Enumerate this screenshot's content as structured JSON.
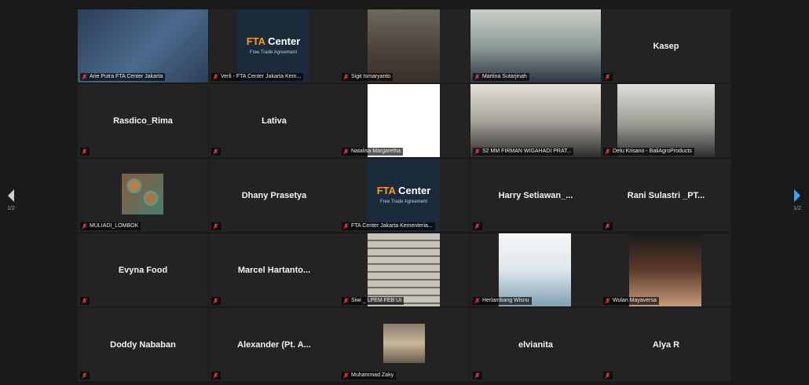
{
  "participants": [
    {
      "kind": "video",
      "video": "v-slide",
      "label": "Arie Putra FTA Center Jakarta",
      "active": true
    },
    {
      "kind": "video",
      "video": "v-fta",
      "label": "Verli - FTA Center Jakarta Kem...",
      "fta": true
    },
    {
      "kind": "video",
      "video": "v-room",
      "label": "Sigit Ismaryanto"
    },
    {
      "kind": "video",
      "video": "v-person1",
      "label": "Martina Sutarjinah"
    },
    {
      "kind": "name",
      "name": "Kasep"
    },
    {
      "kind": "name",
      "name": "Rasdico_Rima"
    },
    {
      "kind": "name",
      "name": "Lativa"
    },
    {
      "kind": "video",
      "video": "v-white",
      "label": "Natalisa Margaretha"
    },
    {
      "kind": "video",
      "video": "v-office",
      "label": "S2 MM FIRMAN WIGAHADI PRAT..."
    },
    {
      "kind": "video",
      "video": "v-office2",
      "label": "Detu Krisano - BaliAgroProducts"
    },
    {
      "kind": "video",
      "video": "v-cookies",
      "label": "MULIADI_LOMBOK"
    },
    {
      "kind": "name",
      "name": "Dhany Prasetya"
    },
    {
      "kind": "video",
      "video": "v-fta",
      "label": "FTA Center Jakarta Kementeria...",
      "fta": true
    },
    {
      "kind": "name",
      "name": "Harry  Setiawan_..."
    },
    {
      "kind": "name",
      "name": "Rani Sulastri _PT..."
    },
    {
      "kind": "name",
      "name": "Evyna Food"
    },
    {
      "kind": "name",
      "name": "Marcel  Hartanto..."
    },
    {
      "kind": "video",
      "video": "v-building",
      "label": "Siwi _ LPEM FEB UI"
    },
    {
      "kind": "video",
      "video": "v-person2",
      "label": "Herlambang Wisnu"
    },
    {
      "kind": "video",
      "video": "v-person3",
      "label": "Wulan Mayaversa"
    },
    {
      "kind": "name",
      "name": "Doddy Nababan"
    },
    {
      "kind": "name",
      "name": "Alexander  (Pt.  A..."
    },
    {
      "kind": "video",
      "video": "v-hall",
      "label": "Muhammad Zaky"
    },
    {
      "kind": "name",
      "name": "elvianita"
    },
    {
      "kind": "name",
      "name": "Alya R"
    }
  ],
  "fta_tile": {
    "title_prefix": "FTA ",
    "title_suffix": "Center",
    "subtitle": "Free Trade Agreement"
  },
  "nav": {
    "page_left": "1/2",
    "page_right": "1/2"
  },
  "colors": {
    "active_outline": "#b7d54a",
    "nav_arrow": "#2fa8ff",
    "mic_muted": "#e0393e"
  }
}
